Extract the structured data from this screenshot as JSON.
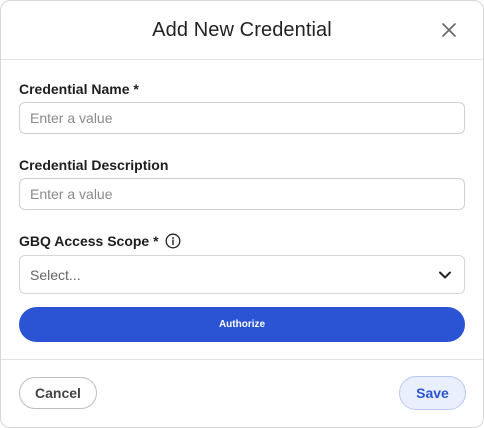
{
  "dialog": {
    "title": "Add New Credential",
    "close_icon": "close-icon"
  },
  "form": {
    "credential_name": {
      "label": "Credential Name *",
      "value": "",
      "placeholder": "Enter a value"
    },
    "credential_description": {
      "label": "Credential Description",
      "value": "",
      "placeholder": "Enter a value"
    },
    "access_scope": {
      "label": "GBQ Access Scope *",
      "info_icon": "info-icon",
      "selected": "Select...",
      "chevron_icon": "chevron-down-icon"
    },
    "authorize_label": "Authorize"
  },
  "footer": {
    "cancel_label": "Cancel",
    "save_label": "Save"
  },
  "colors": {
    "primary": "#2b54d4",
    "save_bg": "#e9effd"
  }
}
